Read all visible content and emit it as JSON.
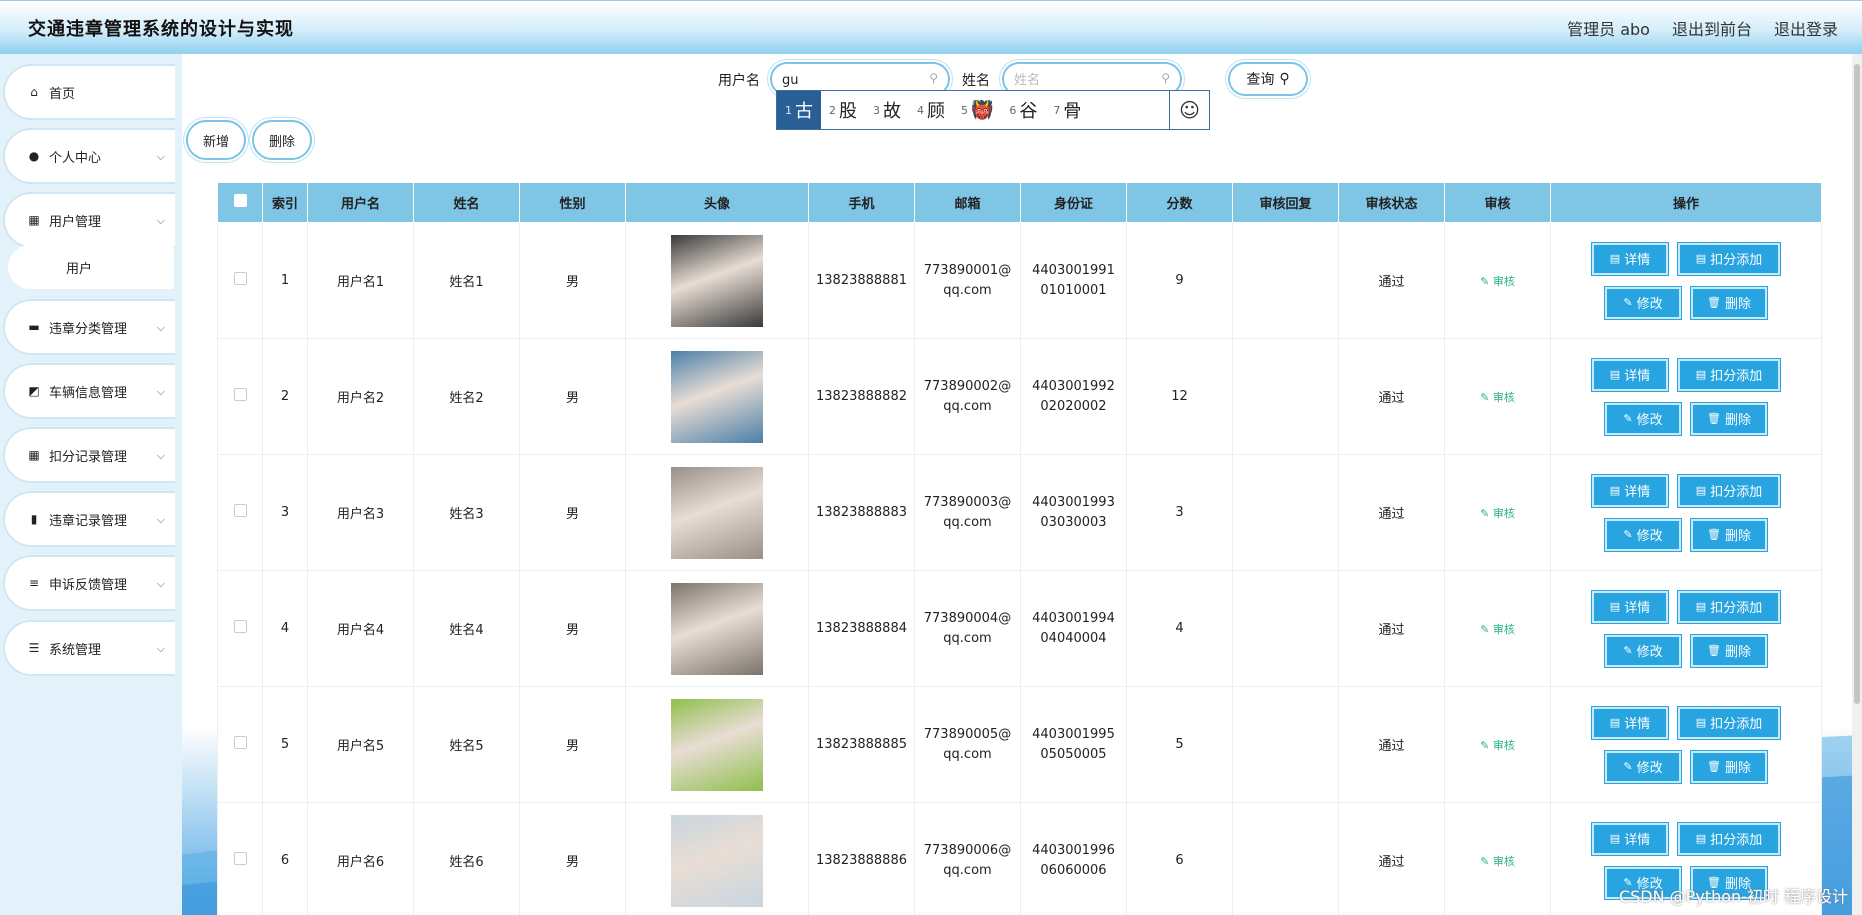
{
  "header": {
    "title": "交通违章管理系统的设计与实现",
    "admin": "管理员 abo",
    "back_front": "退出到前台",
    "logout": "退出登录"
  },
  "sidebar": {
    "items": [
      {
        "label": "首页",
        "icon": "home-icon",
        "glyph": "⌂"
      },
      {
        "label": "个人中心",
        "icon": "user-icon",
        "glyph": "●"
      },
      {
        "label": "用户管理",
        "icon": "grid-icon",
        "glyph": "▦"
      },
      {
        "label": "违章分类管理",
        "icon": "monitor-icon",
        "glyph": "▬"
      },
      {
        "label": "车辆信息管理",
        "icon": "chart-line-icon",
        "glyph": "◩"
      },
      {
        "label": "扣分记录管理",
        "icon": "grid-icon",
        "glyph": "▦"
      },
      {
        "label": "违章记录管理",
        "icon": "bar-chart-icon",
        "glyph": "▮"
      },
      {
        "label": "申诉反馈管理",
        "icon": "sliders-icon",
        "glyph": "≡"
      },
      {
        "label": "系统管理",
        "icon": "list-icon",
        "glyph": "☰"
      }
    ],
    "sub_item": "用户"
  },
  "search": {
    "username_label": "用户名",
    "username_value": "gu",
    "name_label": "姓名",
    "name_placeholder": "姓名",
    "query_label": "查询"
  },
  "ime": {
    "candidates": [
      {
        "n": "1",
        "t": "古"
      },
      {
        "n": "2",
        "t": "股"
      },
      {
        "n": "3",
        "t": "故"
      },
      {
        "n": "4",
        "t": "顾"
      },
      {
        "n": "5",
        "t": "👹"
      },
      {
        "n": "6",
        "t": "谷"
      },
      {
        "n": "7",
        "t": "骨"
      }
    ],
    "emoji": "☺"
  },
  "actions": {
    "add": "新增",
    "delete": "删除"
  },
  "table": {
    "headers": [
      "索引",
      "用户名",
      "姓名",
      "性别",
      "头像",
      "手机",
      "邮箱",
      "身份证",
      "分数",
      "审核回复",
      "审核状态",
      "审核",
      "操作"
    ],
    "audit_link": "审核",
    "btn_detail": "详情",
    "btn_deduct": "扣分添加",
    "btn_edit": "修改",
    "btn_delete": "删除",
    "rows": [
      {
        "index": "1",
        "username": "用户名1",
        "name": "姓名1",
        "gender": "男",
        "phone": "13823888881",
        "email": "773890001@qq.com",
        "idcard": "440300199101010001",
        "score": "9",
        "reply": "",
        "status": "通过",
        "avatar_color": "#3a3a3a"
      },
      {
        "index": "2",
        "username": "用户名2",
        "name": "姓名2",
        "gender": "男",
        "phone": "13823888882",
        "email": "773890002@qq.com",
        "idcard": "440300199202020002",
        "score": "12",
        "reply": "",
        "status": "通过",
        "avatar_color": "#4b7fa8"
      },
      {
        "index": "3",
        "username": "用户名3",
        "name": "姓名3",
        "gender": "男",
        "phone": "13823888883",
        "email": "773890003@qq.com",
        "idcard": "440300199303030003",
        "score": "3",
        "reply": "",
        "status": "通过",
        "avatar_color": "#9a8f88"
      },
      {
        "index": "4",
        "username": "用户名4",
        "name": "姓名4",
        "gender": "男",
        "phone": "13823888884",
        "email": "773890004@qq.com",
        "idcard": "440300199404040004",
        "score": "4",
        "reply": "",
        "status": "通过",
        "avatar_color": "#7b746a"
      },
      {
        "index": "5",
        "username": "用户名5",
        "name": "姓名5",
        "gender": "男",
        "phone": "13823888885",
        "email": "773890005@qq.com",
        "idcard": "440300199505050005",
        "score": "5",
        "reply": "",
        "status": "通过",
        "avatar_color": "#8fbf4c"
      },
      {
        "index": "6",
        "username": "用户名6",
        "name": "姓名6",
        "gender": "男",
        "phone": "13823888886",
        "email": "773890006@qq.com",
        "idcard": "440300199606060006",
        "score": "6",
        "reply": "",
        "status": "通过",
        "avatar_color": "#c9d6e0"
      }
    ]
  },
  "watermark": "CSDN @Python-初时 程序设计"
}
